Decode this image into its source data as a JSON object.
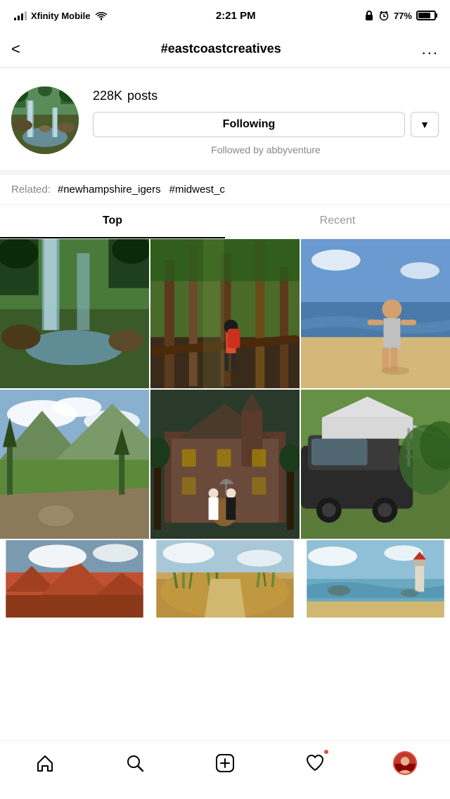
{
  "statusBar": {
    "carrier": "Xfinity Mobile",
    "time": "2:21 PM",
    "battery": "77%"
  },
  "header": {
    "backLabel": "<",
    "title": "#eastcoastcreatives",
    "moreLabel": "..."
  },
  "profile": {
    "postsCount": "228K",
    "postsLabel": " posts",
    "followingLabel": "Following",
    "dropdownLabel": "▼",
    "followedBy": "Followed by abbyventure"
  },
  "related": {
    "label": "Related:",
    "tags": [
      "#newhampshire_igers",
      "#midwest_c"
    ]
  },
  "tabs": [
    {
      "label": "Top",
      "active": true
    },
    {
      "label": "Recent",
      "active": false
    }
  ],
  "bottomNav": {
    "home": "home-icon",
    "search": "search-icon",
    "add": "add-icon",
    "heart": "heart-icon",
    "profile": "profile-icon"
  }
}
